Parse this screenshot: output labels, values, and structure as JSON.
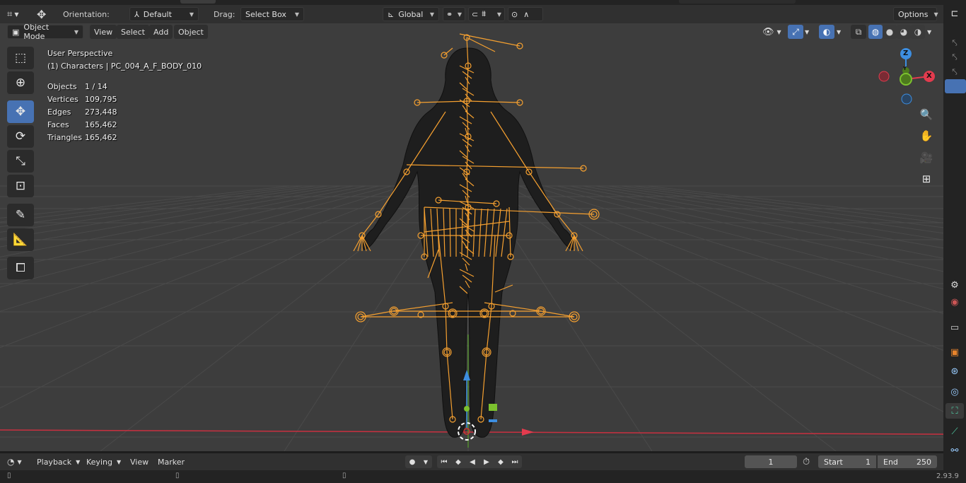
{
  "header": {
    "orientation_label": "Orientation:",
    "orientation_value": "Default",
    "drag_label": "Drag:",
    "drag_value": "Select Box",
    "transform_space": "Global",
    "options_label": "Options"
  },
  "viewport_header": {
    "mode": "Object Mode",
    "menus": [
      "View",
      "Select",
      "Add",
      "Object"
    ]
  },
  "overlay": {
    "perspective": "User Perspective",
    "collection": "(1) Characters | PC_004_A_F_BODY_010",
    "stats": [
      {
        "label": "Objects",
        "value": "1 / 14"
      },
      {
        "label": "Vertices",
        "value": "109,795"
      },
      {
        "label": "Edges",
        "value": "273,448"
      },
      {
        "label": "Faces",
        "value": "165,462"
      },
      {
        "label": "Triangles",
        "value": "165,462"
      }
    ]
  },
  "gizmo": {
    "z": "Z",
    "y": "Y",
    "x": "X",
    "colors": {
      "x": "#e33b4e",
      "y": "#7cc12e",
      "z": "#3d8ee0"
    }
  },
  "toolbar_icons": [
    "select-box-icon",
    "cursor-icon",
    "move-icon",
    "rotate-icon",
    "scale-icon",
    "transform-icon",
    "annotate-icon",
    "measure-icon",
    "add-cube-icon"
  ],
  "timeline": {
    "menus": [
      "Playback",
      "Keying",
      "View",
      "Marker"
    ],
    "current_frame": "1",
    "start_label": "Start",
    "start_value": "1",
    "end_label": "End",
    "end_value": "250"
  },
  "status": {
    "version": "2.93.9"
  },
  "colors": {
    "accent": "#4772b3",
    "armature": "#f5a030",
    "viewport_bg": "#3d3d3d"
  }
}
